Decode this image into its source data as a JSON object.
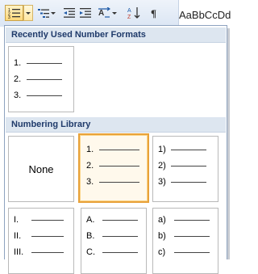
{
  "ribbon": {
    "buttons": [
      {
        "name": "numbering-button-icon"
      },
      {
        "name": "numbering-dropdown-arrow"
      },
      {
        "name": "multilevel-list-button"
      },
      {
        "name": "decrease-indent-icon"
      },
      {
        "name": "increase-indent-icon"
      },
      {
        "name": "sort-icon"
      },
      {
        "name": "show-formatting-icon"
      }
    ],
    "styles_preview": "AaBbCcDd",
    "active_color": "#ffd87a"
  },
  "gallery": {
    "recent_header": "Recently Used Number Formats",
    "library_header": "Numbering Library",
    "recent": [
      {
        "markers": [
          "1.",
          "2.",
          "3."
        ]
      }
    ],
    "library": [
      {
        "label": "None",
        "markers": []
      },
      {
        "markers": [
          "1.",
          "2.",
          "3."
        ],
        "selected": true
      },
      {
        "markers": [
          "1)",
          "2)",
          "3)"
        ]
      },
      {
        "markers": [
          "I.",
          "II.",
          "III."
        ]
      },
      {
        "markers": [
          "A.",
          "B.",
          "C."
        ]
      },
      {
        "markers": [
          "a)",
          "b)",
          "c)"
        ]
      }
    ]
  }
}
